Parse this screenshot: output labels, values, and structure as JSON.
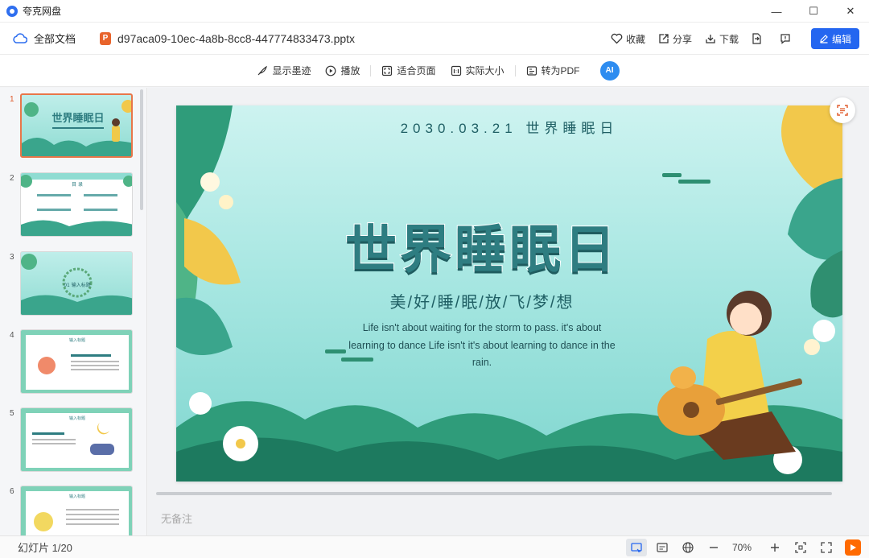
{
  "app": {
    "title": "夸克网盘"
  },
  "window": {
    "minimize": "—",
    "maximize": "☐",
    "close": "✕"
  },
  "filebar": {
    "breadcrumb": "全部文档",
    "filename": "d97aca09-10ec-4a8b-8cc8-447774833473.pptx",
    "file_type_badge": "P",
    "actions": {
      "favorite": "收藏",
      "share": "分享",
      "download": "下载",
      "edit": "编辑"
    }
  },
  "toolbar": {
    "show_ink": "显示墨迹",
    "play": "播放",
    "fit_page": "适合页面",
    "actual_size": "实际大小",
    "to_pdf": "转为PDF",
    "ai_label": "AI"
  },
  "thumbnails": [
    {
      "number": "1",
      "active": true,
      "title": "世界睡眠日"
    },
    {
      "number": "2",
      "active": false,
      "title": "目 录"
    },
    {
      "number": "3",
      "active": false,
      "title": "01 输入标题"
    },
    {
      "number": "4",
      "active": false,
      "title": "输入标题"
    },
    {
      "number": "5",
      "active": false,
      "title": "输入标题"
    },
    {
      "number": "6",
      "active": false,
      "title": "输入标题"
    }
  ],
  "slide": {
    "date": "2030.03.21 世界睡眠日",
    "title": "世界睡眠日",
    "subtitle": "美/好/睡/眠/放/飞/梦/想",
    "body": "Life isn't about waiting for the storm to pass. it's about learning to dance Life isn't it's about learning to dance in the rain."
  },
  "notes_placeholder": "无备注",
  "status": {
    "slide_count": "幻灯片 1/20",
    "zoom": "70%"
  },
  "colors": {
    "accent": "#2466f0",
    "active_thumb": "#e8764a",
    "play": "#ff6a00"
  }
}
